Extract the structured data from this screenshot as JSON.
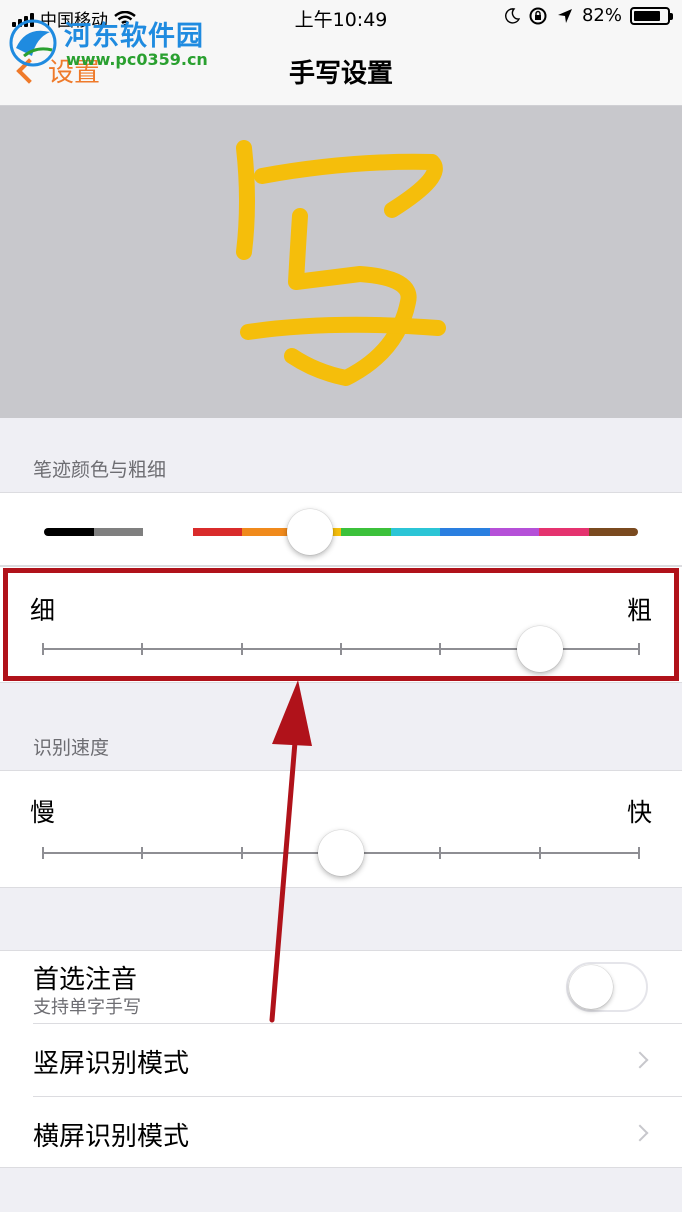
{
  "status_bar": {
    "carrier": "中国移动",
    "time": "上午10:49",
    "battery_percent": "82%",
    "battery_level": 0.82
  },
  "watermark": {
    "name": "河东软件园",
    "url": "www.pc0359.cn"
  },
  "nav": {
    "back_label": "设置",
    "title": "手写设置"
  },
  "colors": {
    "accent": "#ef7a2a",
    "ink": "#f5be0b",
    "highlight": "#b0121a",
    "palette": [
      "#000000",
      "#7f7f7f",
      "#ffffff",
      "#d92b2b",
      "#f08a1c",
      "#f5be0b",
      "#3cc13b",
      "#2bc5d6",
      "#2a7fe0",
      "#b550d8",
      "#e5336f",
      "#7a4a1f"
    ]
  },
  "stroke_section": {
    "header": "笔迹颜色与粗细",
    "color_index": 5,
    "thin_label": "细",
    "thick_label": "粗",
    "thickness_steps": 7,
    "thickness_value": 5
  },
  "speed_section": {
    "header": "识别速度",
    "slow_label": "慢",
    "fast_label": "快",
    "speed_steps": 7,
    "speed_value": 3
  },
  "settings": {
    "pinyin_title": "首选注音",
    "pinyin_subtitle": "支持单字手写",
    "pinyin_enabled": false,
    "portrait_mode": "竖屏识别模式",
    "landscape_mode": "横屏识别模式"
  }
}
